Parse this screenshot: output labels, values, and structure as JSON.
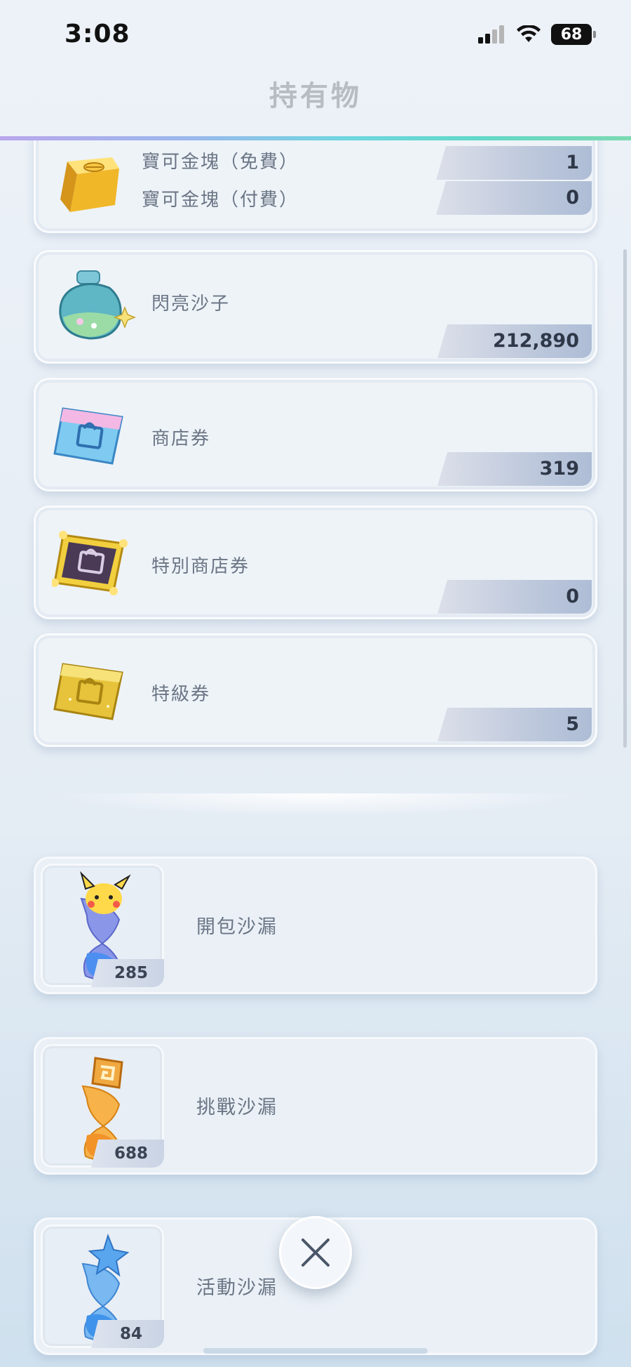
{
  "status_bar": {
    "time": "3:08",
    "battery": "68"
  },
  "header": {
    "title": "持有物"
  },
  "items": [
    {
      "label_free": "寶可金塊（免費）",
      "value_free": "1",
      "label_paid": "寶可金塊（付費）",
      "value_paid": "0",
      "icon": "gold-bar-icon"
    },
    {
      "label": "閃亮沙子",
      "value": "212,890",
      "icon": "shiny-sand-bottle-icon"
    },
    {
      "label": "商店券",
      "value": "319",
      "icon": "shop-ticket-icon"
    },
    {
      "label": "特別商店券",
      "value": "0",
      "icon": "special-shop-ticket-icon"
    },
    {
      "label": "特級券",
      "value": "5",
      "icon": "premium-ticket-icon"
    }
  ],
  "hourglasses": [
    {
      "label": "開包沙漏",
      "count": "285",
      "icon": "pack-hourglass-icon"
    },
    {
      "label": "挑戰沙漏",
      "count": "688",
      "icon": "battle-hourglass-icon"
    },
    {
      "label": "活動沙漏",
      "count": "84",
      "icon": "event-hourglass-icon"
    }
  ],
  "colors": {
    "accent_gradient": [
      "#b9a6ec",
      "#6fd6df",
      "#7cd9b1"
    ],
    "label_text": "#6a7585",
    "value_text": "#2f3848"
  }
}
